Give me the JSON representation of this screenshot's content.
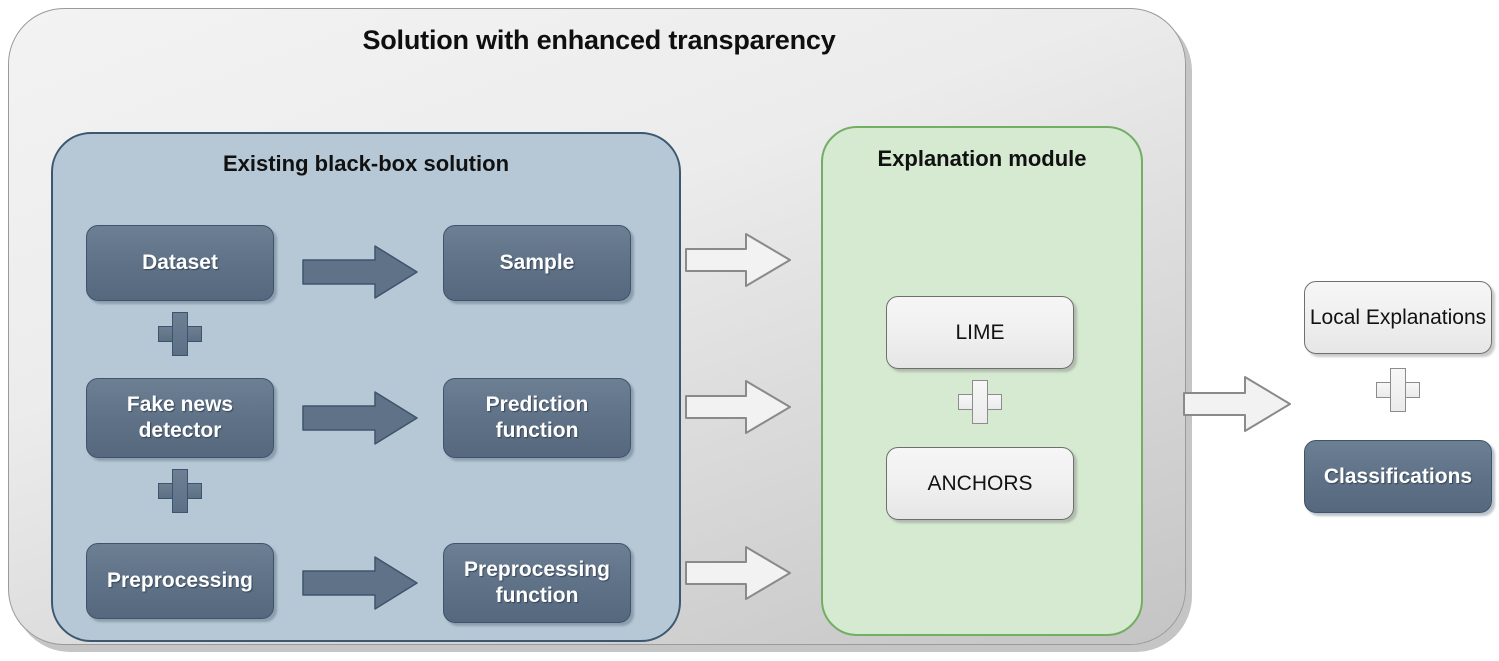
{
  "diagram": {
    "title": "Solution with enhanced transparency",
    "panels": {
      "blackbox": {
        "title": "Existing black-box solution",
        "left_column": [
          {
            "label": "Dataset"
          },
          {
            "label": "Fake news detector"
          },
          {
            "label": "Preprocessing"
          }
        ],
        "right_column": [
          {
            "label": "Sample"
          },
          {
            "label": "Prediction function"
          },
          {
            "label": "Preprocessing function"
          }
        ],
        "connectors": [
          "plus",
          "plus"
        ]
      },
      "explanation": {
        "title": "Explanation module",
        "items": [
          {
            "label": "LIME"
          },
          {
            "label": "ANCHORS"
          }
        ],
        "connector": "plus"
      }
    },
    "outputs": [
      {
        "label": "Local Explanations",
        "style": "light"
      },
      {
        "label": "Classifications",
        "style": "dark"
      }
    ],
    "output_connector": "plus",
    "arrows": {
      "inner_dark_count": 3,
      "bridge_white_count": 3,
      "output_white_count": 1
    },
    "colors": {
      "outer_panel": "#ececec",
      "blue_panel": "#b6c8d6",
      "blue_panel_border": "#3c5871",
      "green_panel": "#d5ead0",
      "green_panel_border": "#72ae63",
      "dark_box": "#5f7287",
      "light_box": "#efefef",
      "text_dark": "#111111",
      "text_light": "#ffffff"
    }
  }
}
